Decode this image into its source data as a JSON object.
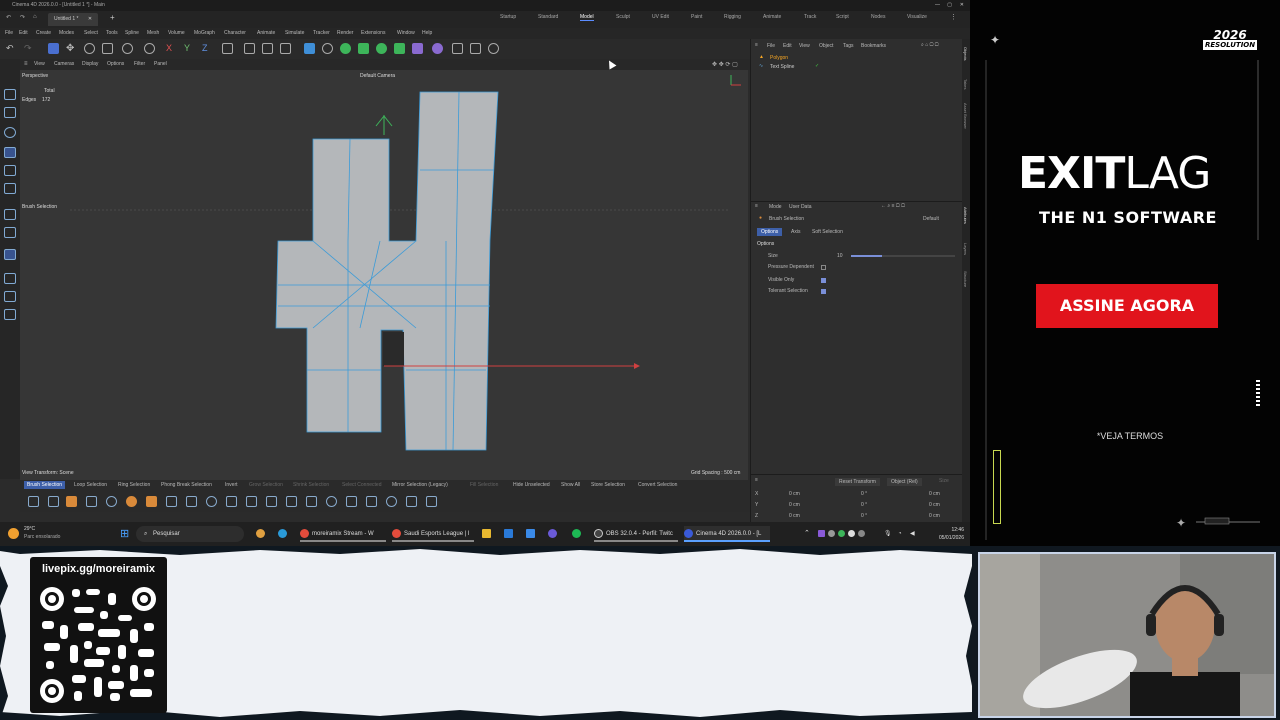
{
  "window": {
    "title": "Cinema 4D 2026.0.0 - [Untitled 1 *] - Main",
    "doc_tab": "Untitled 1 *"
  },
  "layouts": [
    "Startup",
    "Standard",
    "Model",
    "Sculpt",
    "UV Edit",
    "Paint",
    "Rigging",
    "Animate",
    "Track",
    "Script",
    "Nodes",
    "Visualize"
  ],
  "active_layout": "Model",
  "menus": [
    "File",
    "Edit",
    "Create",
    "Modes",
    "Select",
    "Tools",
    "Spline",
    "Mesh",
    "Volume",
    "MoGraph",
    "Character",
    "Animate",
    "Simulate",
    "Tracker",
    "Render",
    "Extensions",
    "Window",
    "Help"
  ],
  "viewport": {
    "menu": [
      "View",
      "Cameras",
      "Display",
      "Options",
      "Filter",
      "Panel"
    ],
    "name": "Perspective",
    "camera": "Default Camera",
    "stats_header": "Total",
    "stats_label": "Edges",
    "stats_value": "172",
    "tool_label": "Brush Selection",
    "view_transform": "View Transform: Scene",
    "grid_spacing": "Grid Spacing : 500 cm"
  },
  "selection_tools": [
    "Brush Selection",
    "Loop Selection",
    "Ring Selection",
    "Phong Break Selection",
    "Invert",
    "Grow Selection",
    "Shrink Selection",
    "Select Connected",
    "Mirror Selection (Legacy)",
    "Fill Selection",
    "Hide Unselected",
    "Show All",
    "Store Selection",
    "Convert Selection"
  ],
  "active_selection_tool": "Brush Selection",
  "object_manager": {
    "menu": [
      "File",
      "Edit",
      "View",
      "Object",
      "Tags",
      "Bookmarks"
    ],
    "objects": [
      "Polygon",
      "Text Spline"
    ]
  },
  "attributes": {
    "menu": [
      "Mode",
      "User Data"
    ],
    "title": "Brush Selection",
    "preset": "Default",
    "tabs": [
      "Options",
      "Axis",
      "Soft Selection"
    ],
    "section": "Options",
    "size_label": "Size",
    "size_value": "10",
    "size_fraction": 0.3,
    "checks": [
      {
        "label": "Pressure Dependent",
        "checked": false
      },
      {
        "label": "Visible Only",
        "checked": true
      },
      {
        "label": "Tolerant Selection",
        "checked": true
      }
    ]
  },
  "coordinates": {
    "reset": "Reset Transform",
    "mode": "Object (Rel)",
    "size_btn": "Size",
    "rows": [
      {
        "axis": "X",
        "pos": "0 cm",
        "rot": "0 °",
        "size": "0 cm"
      },
      {
        "axis": "Y",
        "pos": "0 cm",
        "rot": "0 °",
        "size": "0 cm"
      },
      {
        "axis": "Z",
        "pos": "0 cm",
        "rot": "0 °",
        "size": "0 cm"
      }
    ]
  },
  "side_strip": [
    "Objects",
    "Takes",
    "Asset Browser",
    "Attributes",
    "Layers",
    "Structure"
  ],
  "taskbar": {
    "weather_temp": "29°C",
    "weather_desc": "Parc ensolarado",
    "search": "Pesquisar",
    "apps": [
      "moreiramix Stream - W",
      "Saudi Esports League | I",
      "OBS 32.0.4 - Perfil: Twitc",
      "Cinema 4D 2026.0.0 - [L"
    ],
    "time": "12:46",
    "date": "05/01/2026"
  },
  "ad": {
    "badge_top": "2026",
    "badge_bottom": "RESOLUTION",
    "brand_a": "EXIT",
    "brand_b": "LAG",
    "tagline": "THE N1 SOFTWARE",
    "cta": "ASSINE AGORA",
    "terms": "*VEJA TERMOS",
    "accent_color": "#e1141c"
  },
  "stream": {
    "livepix": "livepix.gg/moreiramix"
  }
}
